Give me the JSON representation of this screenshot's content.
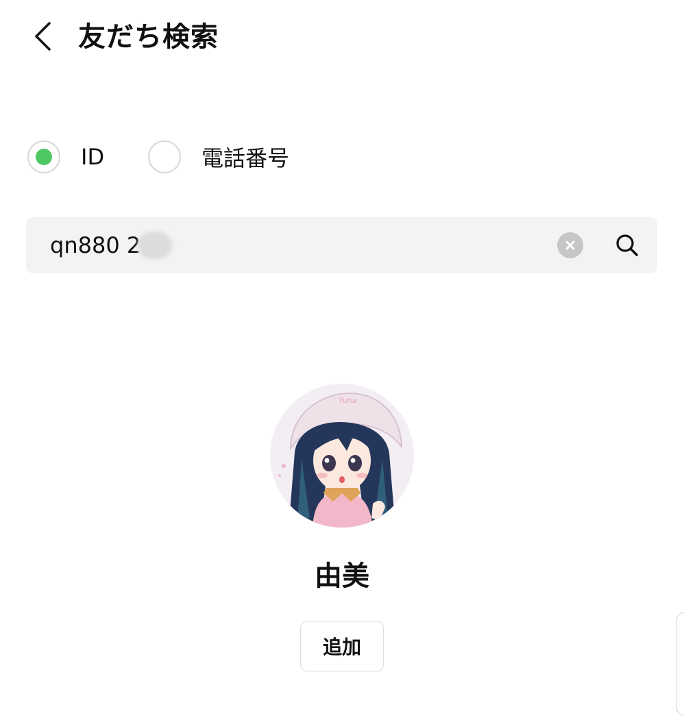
{
  "header": {
    "back_icon": "chevron-left-icon",
    "title": "友だち検索"
  },
  "search_type": {
    "selected": "ID",
    "options": [
      {
        "label": "ID",
        "selected": true
      },
      {
        "label": "電話番号",
        "selected": false
      }
    ],
    "accent_color": "#4cc764"
  },
  "search": {
    "value": "qn880 2",
    "clear_icon": "clear-icon",
    "search_icon": "search-icon"
  },
  "result": {
    "name": "由美",
    "add_label": "追加",
    "avatar_hat_text": "Yuna"
  },
  "colors": {
    "background": "#ffffff",
    "search_field": "#f3f3f3",
    "radio_selected": "#4cc764"
  }
}
